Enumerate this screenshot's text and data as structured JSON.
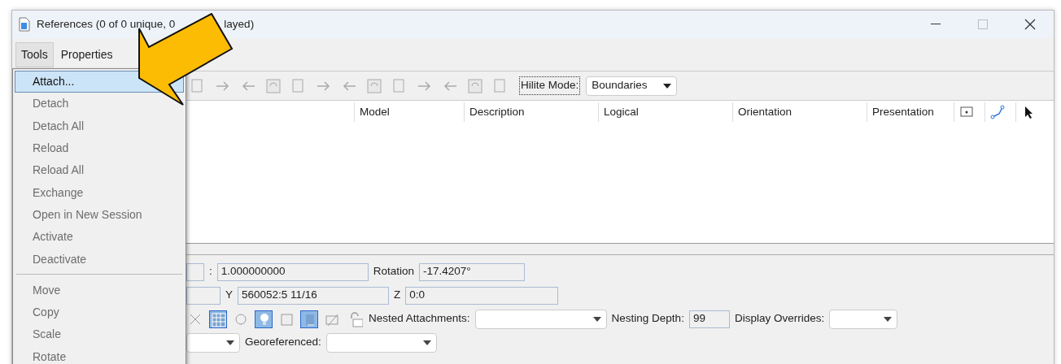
{
  "window": {
    "title_parts": [
      "References (0 of 0 unique, 0",
      "layed)"
    ]
  },
  "menubar": [
    {
      "label": "Tools",
      "selected": true
    },
    {
      "label": "Properties",
      "selected": false
    }
  ],
  "menu": [
    {
      "label": "Attach...",
      "disabled": false,
      "selected": true
    },
    {
      "label": "Detach",
      "disabled": true,
      "selected": false
    },
    {
      "label": "Detach All",
      "disabled": true,
      "selected": false
    },
    {
      "label": "Reload",
      "disabled": true,
      "selected": false
    },
    {
      "label": "Reload All",
      "disabled": true,
      "selected": false
    },
    {
      "label": "Exchange",
      "disabled": true,
      "selected": false
    },
    {
      "label": "Open in New Session",
      "disabled": true,
      "selected": false
    },
    {
      "label": "Activate",
      "disabled": true,
      "selected": false
    },
    {
      "label": "Deactivate",
      "disabled": true,
      "selected": false,
      "separator_after": true
    },
    {
      "label": "Move",
      "disabled": true,
      "selected": false
    },
    {
      "label": "Copy",
      "disabled": true,
      "selected": false
    },
    {
      "label": "Scale",
      "disabled": true,
      "selected": false
    },
    {
      "label": "Rotate",
      "disabled": true,
      "selected": false
    }
  ],
  "toolbar": {
    "hilite_label": "Hilite Mode:",
    "hilite_value": "Boundaries"
  },
  "table": {
    "columns": [
      "Model",
      "Description",
      "Logical",
      "Orientation",
      "Presentation"
    ]
  },
  "fields": {
    "scale_sep": ":",
    "scale": "1.000000000",
    "rotation_label": "Rotation",
    "rotation": "-17.4207°",
    "y_label": "Y",
    "y": "560052:5 11/16",
    "z_label": "Z",
    "z": "0:0"
  },
  "toggles": [
    {
      "on": false
    },
    {
      "on": true
    },
    {
      "on": false
    },
    {
      "on": true
    },
    {
      "on": false
    },
    {
      "on": true
    },
    {
      "on": false
    },
    {
      "on": false
    }
  ],
  "nested_label": "Nested Attachments:",
  "nesting_depth_label": "Nesting Depth:",
  "nesting_depth": "99",
  "display_overrides_label": "Display Overrides:",
  "georeferenced_label": "Georeferenced:"
}
